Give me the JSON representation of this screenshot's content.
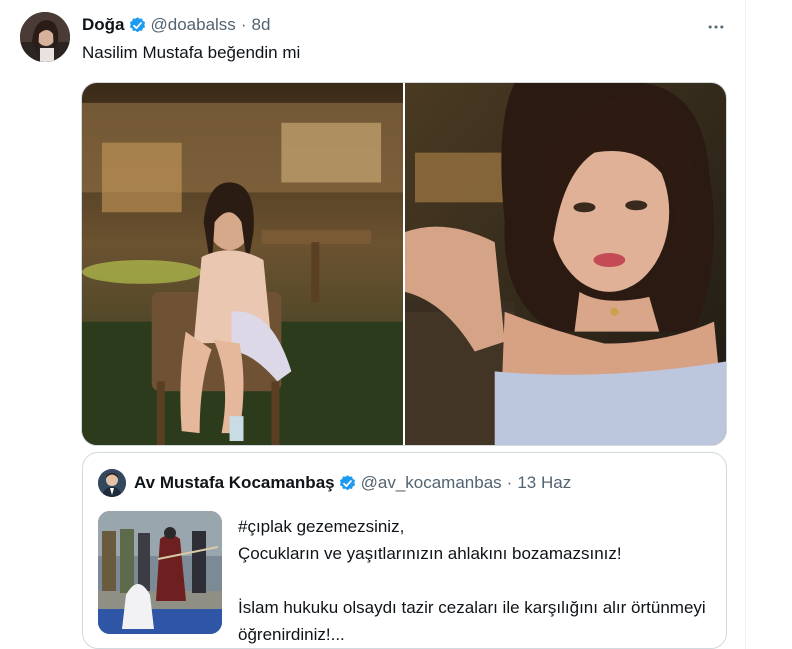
{
  "tweet": {
    "author_name": "Doğa",
    "author_handle": "@doabalss",
    "separator": "·",
    "time_ago": "8d",
    "more_icon": "more-horizontal-icon",
    "text": "Nasilim Mustafa beğendin mi",
    "images": [
      {
        "icon": "photo-woman-sitting-cafe"
      },
      {
        "icon": "photo-woman-selfie"
      }
    ]
  },
  "quoted_tweet": {
    "author_name": "Av Mustafa Kocamanbaş",
    "author_handle": "@av_kocamanbas",
    "separator": "·",
    "time_ago": "13 Haz",
    "text": "#çıplak gezemezsiniz,\nÇocukların ve yaşıtlarınızın ahlakını bozamazsınız!\n\nİslam hukuku olsaydı tazir cezaları ile karşılığını alır örtünmeyi öğrenirdiniz!...",
    "thumbnail_icon": "photo-public-punishment"
  },
  "colors": {
    "verified_blue": "#1d9bf0",
    "secondary_text": "#536471",
    "border": "#cfd9de"
  }
}
